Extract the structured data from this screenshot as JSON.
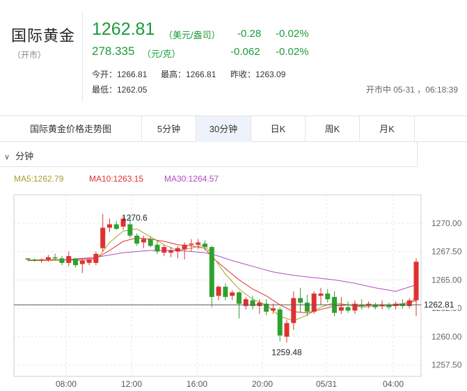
{
  "header": {
    "title": "国际黄金",
    "subtitle": "（开市）",
    "price_usd": "1262.81",
    "unit_usd": "（美元/盎司）",
    "change_usd": "-0.28",
    "change_pct_usd": "-0.02%",
    "price_cny": "278.335",
    "unit_cny": "（元/克）",
    "change_cny": "-0.062",
    "change_pct_cny": "-0.02%",
    "open": "今开：1266.81",
    "high": "最高：1266.81",
    "prev_close": "昨收：1263.09",
    "low": "最低：1262.05",
    "status": "开市中 05-31 ，06:18:39",
    "color_down": "#1a9b3a"
  },
  "tabs": [
    {
      "label": "国际黄金价格走势图"
    },
    {
      "label": "5分钟"
    },
    {
      "label": "30分钟"
    },
    {
      "label": "日K"
    },
    {
      "label": "周K"
    },
    {
      "label": "月K"
    }
  ],
  "period": {
    "chevron_icon": "chevron-down-icon",
    "label": "分钟"
  },
  "ma": {
    "ma5": "MA5:1262.79",
    "ma10": "MA10:1263.15",
    "ma30": "MA30:1264.57",
    "ma5_color": "#a3a02a",
    "ma10_color": "#e03131",
    "ma30_color": "#b04cc0"
  },
  "chart_data": {
    "type": "candlestick",
    "ylim": [
      1256.5,
      1272.5
    ],
    "y_ticks": [
      "1270.00",
      "1267.50",
      "1265.00",
      "1262.50",
      "1260.00",
      "1257.50"
    ],
    "x_ticks": [
      "08:00",
      "12:00",
      "16:00",
      "20:00",
      "05/31",
      "04:00"
    ],
    "annotations": {
      "high": "1270.6",
      "low": "1259.48",
      "current": "1262.81"
    },
    "up_color": "#e03131",
    "down_color": "#2fa12f",
    "candles": [
      [
        1266.9,
        1266.9,
        1266.7,
        1266.8
      ],
      [
        1266.8,
        1266.9,
        1266.6,
        1266.7
      ],
      [
        1266.7,
        1266.9,
        1266.5,
        1266.8
      ],
      [
        1266.8,
        1267.2,
        1266.6,
        1267.0
      ],
      [
        1267.0,
        1267.3,
        1266.7,
        1266.9
      ],
      [
        1266.9,
        1267.1,
        1266.3,
        1266.5
      ],
      [
        1266.5,
        1267.5,
        1266.2,
        1267.1
      ],
      [
        1266.9,
        1266.9,
        1266.1,
        1266.3
      ],
      [
        1266.4,
        1266.9,
        1265.6,
        1266.7
      ],
      [
        1266.5,
        1266.9,
        1266.3,
        1266.8
      ],
      [
        1266.5,
        1267.5,
        1266.3,
        1267.3
      ],
      [
        1267.8,
        1270.8,
        1267.5,
        1269.6
      ],
      [
        1269.6,
        1270.4,
        1269.2,
        1269.9
      ],
      [
        1269.9,
        1270.2,
        1269.4,
        1269.5
      ],
      [
        1269.7,
        1270.6,
        1269.4,
        1270.4
      ],
      [
        1269.9,
        1270.6,
        1268.7,
        1268.9
      ],
      [
        1268.9,
        1269.1,
        1268.0,
        1268.2
      ],
      [
        1268.3,
        1268.9,
        1267.8,
        1268.6
      ],
      [
        1268.6,
        1268.8,
        1267.9,
        1268.0
      ],
      [
        1268.1,
        1268.5,
        1267.3,
        1267.5
      ],
      [
        1267.4,
        1268.1,
        1267.1,
        1267.9
      ],
      [
        1267.4,
        1267.9,
        1267.0,
        1267.6
      ],
      [
        1267.5,
        1268.0,
        1266.9,
        1267.8
      ],
      [
        1267.7,
        1268.3,
        1266.8,
        1268.1
      ],
      [
        1268.1,
        1268.6,
        1267.5,
        1268.2
      ],
      [
        1268.1,
        1268.6,
        1267.7,
        1268.3
      ],
      [
        1268.2,
        1268.5,
        1267.6,
        1267.9
      ],
      [
        1267.9,
        1268.0,
        1262.6,
        1263.5
      ],
      [
        1263.6,
        1264.5,
        1263.2,
        1264.4
      ],
      [
        1264.4,
        1264.7,
        1263.2,
        1263.5
      ],
      [
        1263.6,
        1264.1,
        1263.2,
        1263.9
      ],
      [
        1263.9,
        1264.0,
        1261.6,
        1262.9
      ],
      [
        1262.7,
        1263.5,
        1262.4,
        1263.3
      ],
      [
        1263.2,
        1263.6,
        1262.4,
        1262.7
      ],
      [
        1262.7,
        1263.3,
        1262.0,
        1263.0
      ],
      [
        1262.9,
        1263.3,
        1261.9,
        1262.2
      ],
      [
        1262.3,
        1262.9,
        1262.0,
        1262.5
      ],
      [
        1262.4,
        1262.6,
        1259.6,
        1260.1
      ],
      [
        1260.0,
        1261.5,
        1259.48,
        1261.2
      ],
      [
        1261.2,
        1264.0,
        1260.6,
        1263.4
      ],
      [
        1263.4,
        1264.3,
        1262.1,
        1263.0
      ],
      [
        1263.0,
        1263.7,
        1261.8,
        1262.2
      ],
      [
        1262.2,
        1264.0,
        1262.0,
        1263.8
      ],
      [
        1263.6,
        1264.3,
        1262.8,
        1263.8
      ],
      [
        1263.8,
        1264.2,
        1263.0,
        1263.3
      ],
      [
        1263.5,
        1264.0,
        1261.8,
        1262.1
      ],
      [
        1262.3,
        1263.5,
        1262.0,
        1262.6
      ],
      [
        1262.6,
        1263.1,
        1262.1,
        1262.3
      ],
      [
        1262.3,
        1263.2,
        1262.0,
        1262.9
      ],
      [
        1262.8,
        1263.3,
        1262.4,
        1262.7
      ],
      [
        1262.8,
        1263.1,
        1262.5,
        1262.9
      ],
      [
        1262.8,
        1263.0,
        1262.4,
        1262.6
      ],
      [
        1262.7,
        1263.2,
        1262.4,
        1262.8
      ],
      [
        1262.8,
        1263.0,
        1262.4,
        1262.6
      ],
      [
        1262.7,
        1263.1,
        1262.4,
        1262.9
      ],
      [
        1262.9,
        1263.3,
        1262.5,
        1262.7
      ],
      [
        1262.7,
        1263.4,
        1262.5,
        1263.2
      ],
      [
        1263.2,
        1266.9,
        1261.8,
        1266.6
      ]
    ],
    "ma5": [
      [
        0,
        1266.75
      ],
      [
        4,
        1266.8
      ],
      [
        8,
        1266.7
      ],
      [
        10,
        1266.8
      ],
      [
        11,
        1267.5
      ],
      [
        12,
        1268.3
      ],
      [
        14,
        1269.3
      ],
      [
        16,
        1269.5
      ],
      [
        18,
        1268.8
      ],
      [
        20,
        1268.1
      ],
      [
        22,
        1267.6
      ],
      [
        24,
        1267.8
      ],
      [
        26,
        1268.1
      ],
      [
        27,
        1267.2
      ],
      [
        29,
        1265.5
      ],
      [
        31,
        1264.2
      ],
      [
        33,
        1263.3
      ],
      [
        35,
        1262.8
      ],
      [
        37,
        1261.8
      ],
      [
        39,
        1261.4
      ],
      [
        41,
        1261.9
      ],
      [
        43,
        1262.6
      ],
      [
        45,
        1263.0
      ],
      [
        47,
        1262.8
      ],
      [
        49,
        1262.6
      ],
      [
        51,
        1262.7
      ],
      [
        53,
        1262.7
      ],
      [
        55,
        1262.8
      ],
      [
        56,
        1262.8
      ],
      [
        57,
        1263.6
      ]
    ],
    "ma10": [
      [
        0,
        1266.7
      ],
      [
        6,
        1266.75
      ],
      [
        10,
        1266.9
      ],
      [
        12,
        1267.6
      ],
      [
        14,
        1268.4
      ],
      [
        16,
        1268.7
      ],
      [
        18,
        1268.6
      ],
      [
        20,
        1268.4
      ],
      [
        22,
        1268.1
      ],
      [
        24,
        1268.0
      ],
      [
        26,
        1267.8
      ],
      [
        27,
        1267.0
      ],
      [
        29,
        1266.0
      ],
      [
        31,
        1265.0
      ],
      [
        33,
        1264.2
      ],
      [
        35,
        1263.6
      ],
      [
        37,
        1262.8
      ],
      [
        39,
        1262.2
      ],
      [
        41,
        1262.1
      ],
      [
        43,
        1262.4
      ],
      [
        45,
        1262.7
      ],
      [
        47,
        1262.8
      ],
      [
        49,
        1262.7
      ],
      [
        51,
        1262.8
      ],
      [
        53,
        1262.8
      ],
      [
        55,
        1262.9
      ],
      [
        57,
        1263.15
      ]
    ],
    "ma30": [
      [
        0,
        1266.7
      ],
      [
        6,
        1266.8
      ],
      [
        10,
        1267.0
      ],
      [
        14,
        1267.4
      ],
      [
        18,
        1267.6
      ],
      [
        22,
        1267.6
      ],
      [
        26,
        1267.4
      ],
      [
        28,
        1267.1
      ],
      [
        30,
        1266.7
      ],
      [
        33,
        1266.2
      ],
      [
        36,
        1265.7
      ],
      [
        39,
        1265.4
      ],
      [
        42,
        1265.2
      ],
      [
        45,
        1265.0
      ],
      [
        48,
        1264.7
      ],
      [
        51,
        1264.3
      ],
      [
        54,
        1264.0
      ],
      [
        57,
        1264.57
      ]
    ]
  }
}
